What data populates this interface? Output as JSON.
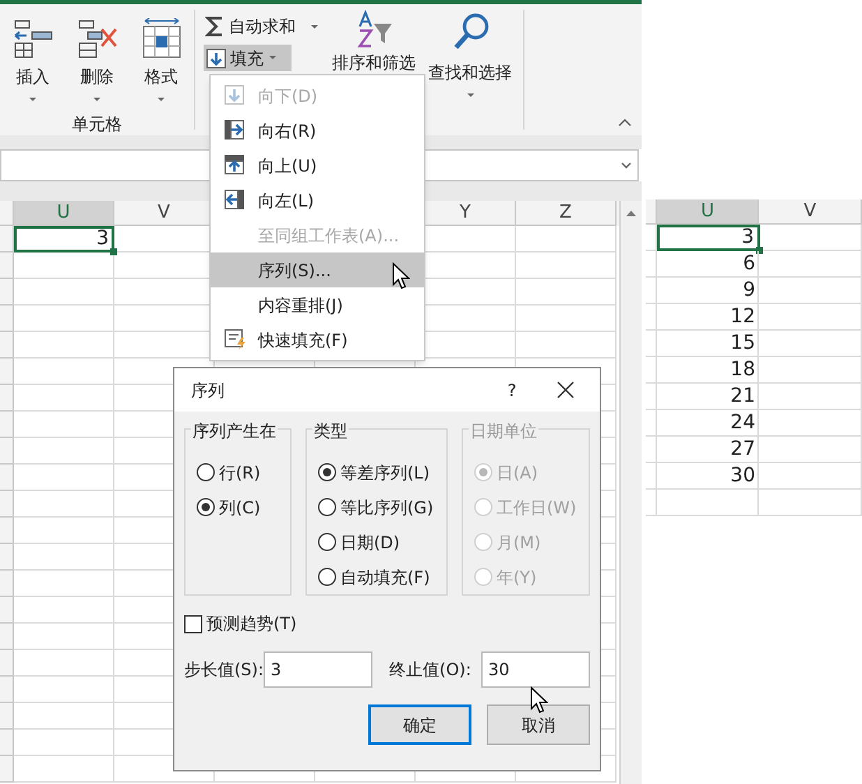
{
  "ribbon": {
    "cells_group": {
      "buttons": [
        {
          "label": "插入",
          "kind": "insert"
        },
        {
          "label": "删除",
          "kind": "delete"
        },
        {
          "label": "格式",
          "kind": "format"
        }
      ],
      "label": "单元格"
    },
    "editing": {
      "autosum": "自动求和",
      "fill": {
        "label": "填充",
        "selected": true
      },
      "sort_filter": "排序和筛选",
      "find_select": "查找和选择"
    }
  },
  "sheet": {
    "columns": [
      {
        "label": "U",
        "selected": true
      },
      {
        "label": "V",
        "selected": false
      },
      {
        "label": "Y",
        "selected": false
      },
      {
        "label": "Z",
        "selected": false
      }
    ],
    "active_cell": "3"
  },
  "fill_menu": [
    {
      "label": "向下(D)",
      "kind": "down",
      "disabled": true,
      "selected": false
    },
    {
      "label": "向右(R)",
      "kind": "right",
      "disabled": false,
      "selected": false
    },
    {
      "label": "向上(U)",
      "kind": "up",
      "disabled": false,
      "selected": false
    },
    {
      "label": "向左(L)",
      "kind": "left",
      "disabled": false,
      "selected": false
    },
    {
      "label": "至同组工作表(A)...",
      "kind": "plain",
      "disabled": true,
      "selected": false
    },
    {
      "label": "序列(S)...",
      "kind": "plain",
      "disabled": false,
      "selected": true
    },
    {
      "label": "内容重排(J)",
      "kind": "plain",
      "disabled": false,
      "selected": false
    },
    {
      "label": "快速填充(F)",
      "kind": "flash",
      "disabled": false,
      "selected": false
    }
  ],
  "dialog": {
    "title": "序列",
    "help": "?",
    "groups": [
      {
        "title": "序列产生在",
        "disabled": false,
        "options": [
          {
            "label": "行(R)",
            "selected": false
          },
          {
            "label": "列(C)",
            "selected": true
          }
        ]
      },
      {
        "title": "类型",
        "disabled": false,
        "options": [
          {
            "label": "等差序列(L)",
            "selected": true
          },
          {
            "label": "等比序列(G)",
            "selected": false
          },
          {
            "label": "日期(D)",
            "selected": false
          },
          {
            "label": "自动填充(F)",
            "selected": false
          }
        ]
      },
      {
        "title": "日期单位",
        "disabled": true,
        "options": [
          {
            "label": "日(A)",
            "selected": true
          },
          {
            "label": "工作日(W)",
            "selected": false
          },
          {
            "label": "月(M)",
            "selected": false
          },
          {
            "label": "年(Y)",
            "selected": false
          }
        ]
      }
    ],
    "trend": {
      "label": "预测趋势(T)",
      "checked": false
    },
    "step": {
      "label": "步长值(S):",
      "value": "3"
    },
    "stop": {
      "label": "终止值(O):",
      "value": "30"
    },
    "buttons": [
      {
        "label": "确定",
        "default": true
      },
      {
        "label": "取消",
        "default": false
      }
    ]
  },
  "result_sheet": {
    "columns": [
      {
        "label": "U",
        "selected": true
      },
      {
        "label": "V",
        "selected": false
      }
    ],
    "rows": [
      {
        "value": "3",
        "selected": true
      },
      {
        "value": "6",
        "selected": false
      },
      {
        "value": "9",
        "selected": false
      },
      {
        "value": "12",
        "selected": false
      },
      {
        "value": "15",
        "selected": false
      },
      {
        "value": "18",
        "selected": false
      },
      {
        "value": "21",
        "selected": false
      },
      {
        "value": "24",
        "selected": false
      },
      {
        "value": "27",
        "selected": false
      },
      {
        "value": "30",
        "selected": false
      }
    ]
  }
}
